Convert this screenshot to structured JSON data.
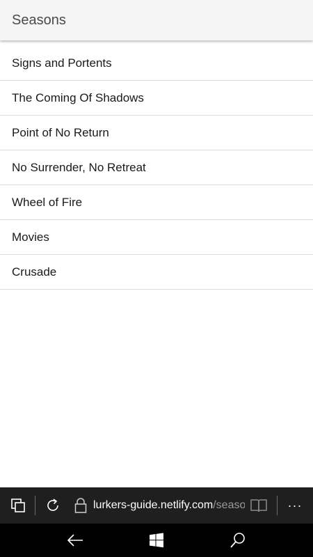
{
  "header": {
    "title": "Seasons"
  },
  "seasons": [
    {
      "label": "Signs and Portents"
    },
    {
      "label": "The Coming Of Shadows"
    },
    {
      "label": "Point of No Return"
    },
    {
      "label": "No Surrender, No Retreat"
    },
    {
      "label": "Wheel of Fire"
    },
    {
      "label": "Movies"
    },
    {
      "label": "Crusade"
    }
  ],
  "browser": {
    "url_host": "lurkers-guide.netlify.com",
    "url_path": "/seaso",
    "icons": {
      "tabs": "tabs-icon",
      "refresh": "refresh-icon",
      "lock": "lock-icon",
      "reading_view": "reading-view-icon",
      "more": "more-icon"
    },
    "more_label": "···"
  },
  "nav": {
    "icons": [
      "back-arrow-icon",
      "windows-start-icon",
      "search-icon"
    ]
  },
  "colors": {
    "header_bg": "#f5f5f5",
    "browser_bar_bg": "#1f1f1f",
    "nav_bar_bg": "#000000",
    "url_path": "#9a9a9a"
  }
}
